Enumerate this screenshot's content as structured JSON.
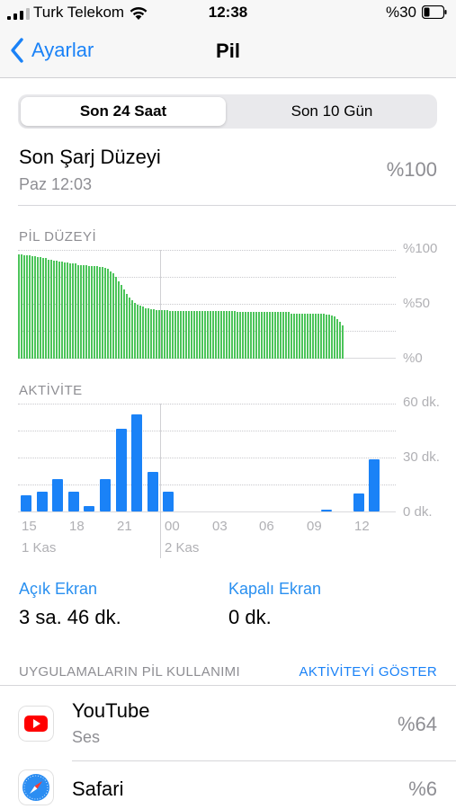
{
  "status_bar": {
    "carrier": "Turk Telekom",
    "time": "12:38",
    "battery_percent": "%30",
    "battery_level": 0.3
  },
  "nav": {
    "back_label": "Ayarlar",
    "title": "Pil"
  },
  "segments": {
    "selected": "Son 24 Saat",
    "other": "Son 10 Gün"
  },
  "last_charge": {
    "title": "Son Şarj Düzeyi",
    "time": "Paz 12:03",
    "value": "%100"
  },
  "colors": {
    "accent": "#1a82f7",
    "battery_bar": "#4cc45a",
    "activity_bar": "#1a82f7",
    "secondary_text": "#8e8e93"
  },
  "battery_chart": {
    "label": "PİL DÜZEYİ",
    "y_labels": [
      "%100",
      "%50",
      "%0"
    ],
    "type": "bar",
    "ylim": [
      0,
      100
    ]
  },
  "activity_chart": {
    "label": "AKTİVİTE",
    "y_labels": [
      "60 dk.",
      "30 dk.",
      "0 dk."
    ],
    "x_labels": [
      "15",
      "18",
      "21",
      "00",
      "03",
      "06",
      "09",
      "12"
    ],
    "day_labels": [
      "1 Kas",
      "2 Kas"
    ],
    "type": "bar",
    "ylim": [
      0,
      60
    ]
  },
  "chart_data": [
    {
      "type": "bar",
      "title": "PİL DÜZEYİ",
      "ylim": [
        0,
        100
      ],
      "values": [
        97,
        97,
        96,
        96,
        96,
        95,
        95,
        94,
        94,
        93,
        93,
        92,
        92,
        91,
        91,
        90,
        90,
        89,
        89,
        88,
        88,
        88,
        87,
        87,
        87,
        87,
        86,
        86,
        86,
        86,
        85,
        85,
        84,
        83,
        81,
        79,
        76,
        72,
        68,
        64,
        60,
        57,
        54,
        52,
        50,
        49,
        48,
        47,
        47,
        46,
        46,
        45,
        45,
        45,
        45,
        45,
        44,
        44,
        44,
        44,
        44,
        44,
        44,
        44,
        44,
        44,
        44,
        44,
        44,
        44,
        44,
        44,
        44,
        44,
        44,
        44,
        44,
        44,
        44,
        44,
        44,
        43,
        43,
        43,
        43,
        43,
        43,
        43,
        43,
        43,
        43,
        43,
        43,
        43,
        43,
        43,
        43,
        43,
        43,
        43,
        43,
        42,
        42,
        42,
        42,
        42,
        42,
        42,
        42,
        42,
        42,
        42,
        42,
        42,
        41,
        41,
        40,
        39,
        37,
        34,
        31
      ]
    },
    {
      "type": "bar",
      "title": "AKTİVİTE",
      "ylim": [
        0,
        60
      ],
      "values": [
        9,
        11,
        18,
        11,
        3,
        18,
        46,
        54,
        22,
        11,
        0,
        0,
        0,
        0,
        0,
        0,
        0,
        0,
        0,
        1,
        0,
        10,
        29
      ]
    }
  ],
  "screen_time": {
    "on_label": "Açık Ekran",
    "on_value": "3 sa. 46 dk.",
    "off_label": "Kapalı Ekran",
    "off_value": "0 dk."
  },
  "apps_section": {
    "header": "UYGULAMALARIN PİL KULLANIMI",
    "action": "AKTİVİTEYİ GÖSTER",
    "apps": [
      {
        "name": "YouTube",
        "sub": "Ses",
        "percent": "%64",
        "icon": "youtube-icon"
      },
      {
        "name": "Safari",
        "sub": "",
        "percent": "%6",
        "icon": "safari-icon"
      }
    ]
  }
}
